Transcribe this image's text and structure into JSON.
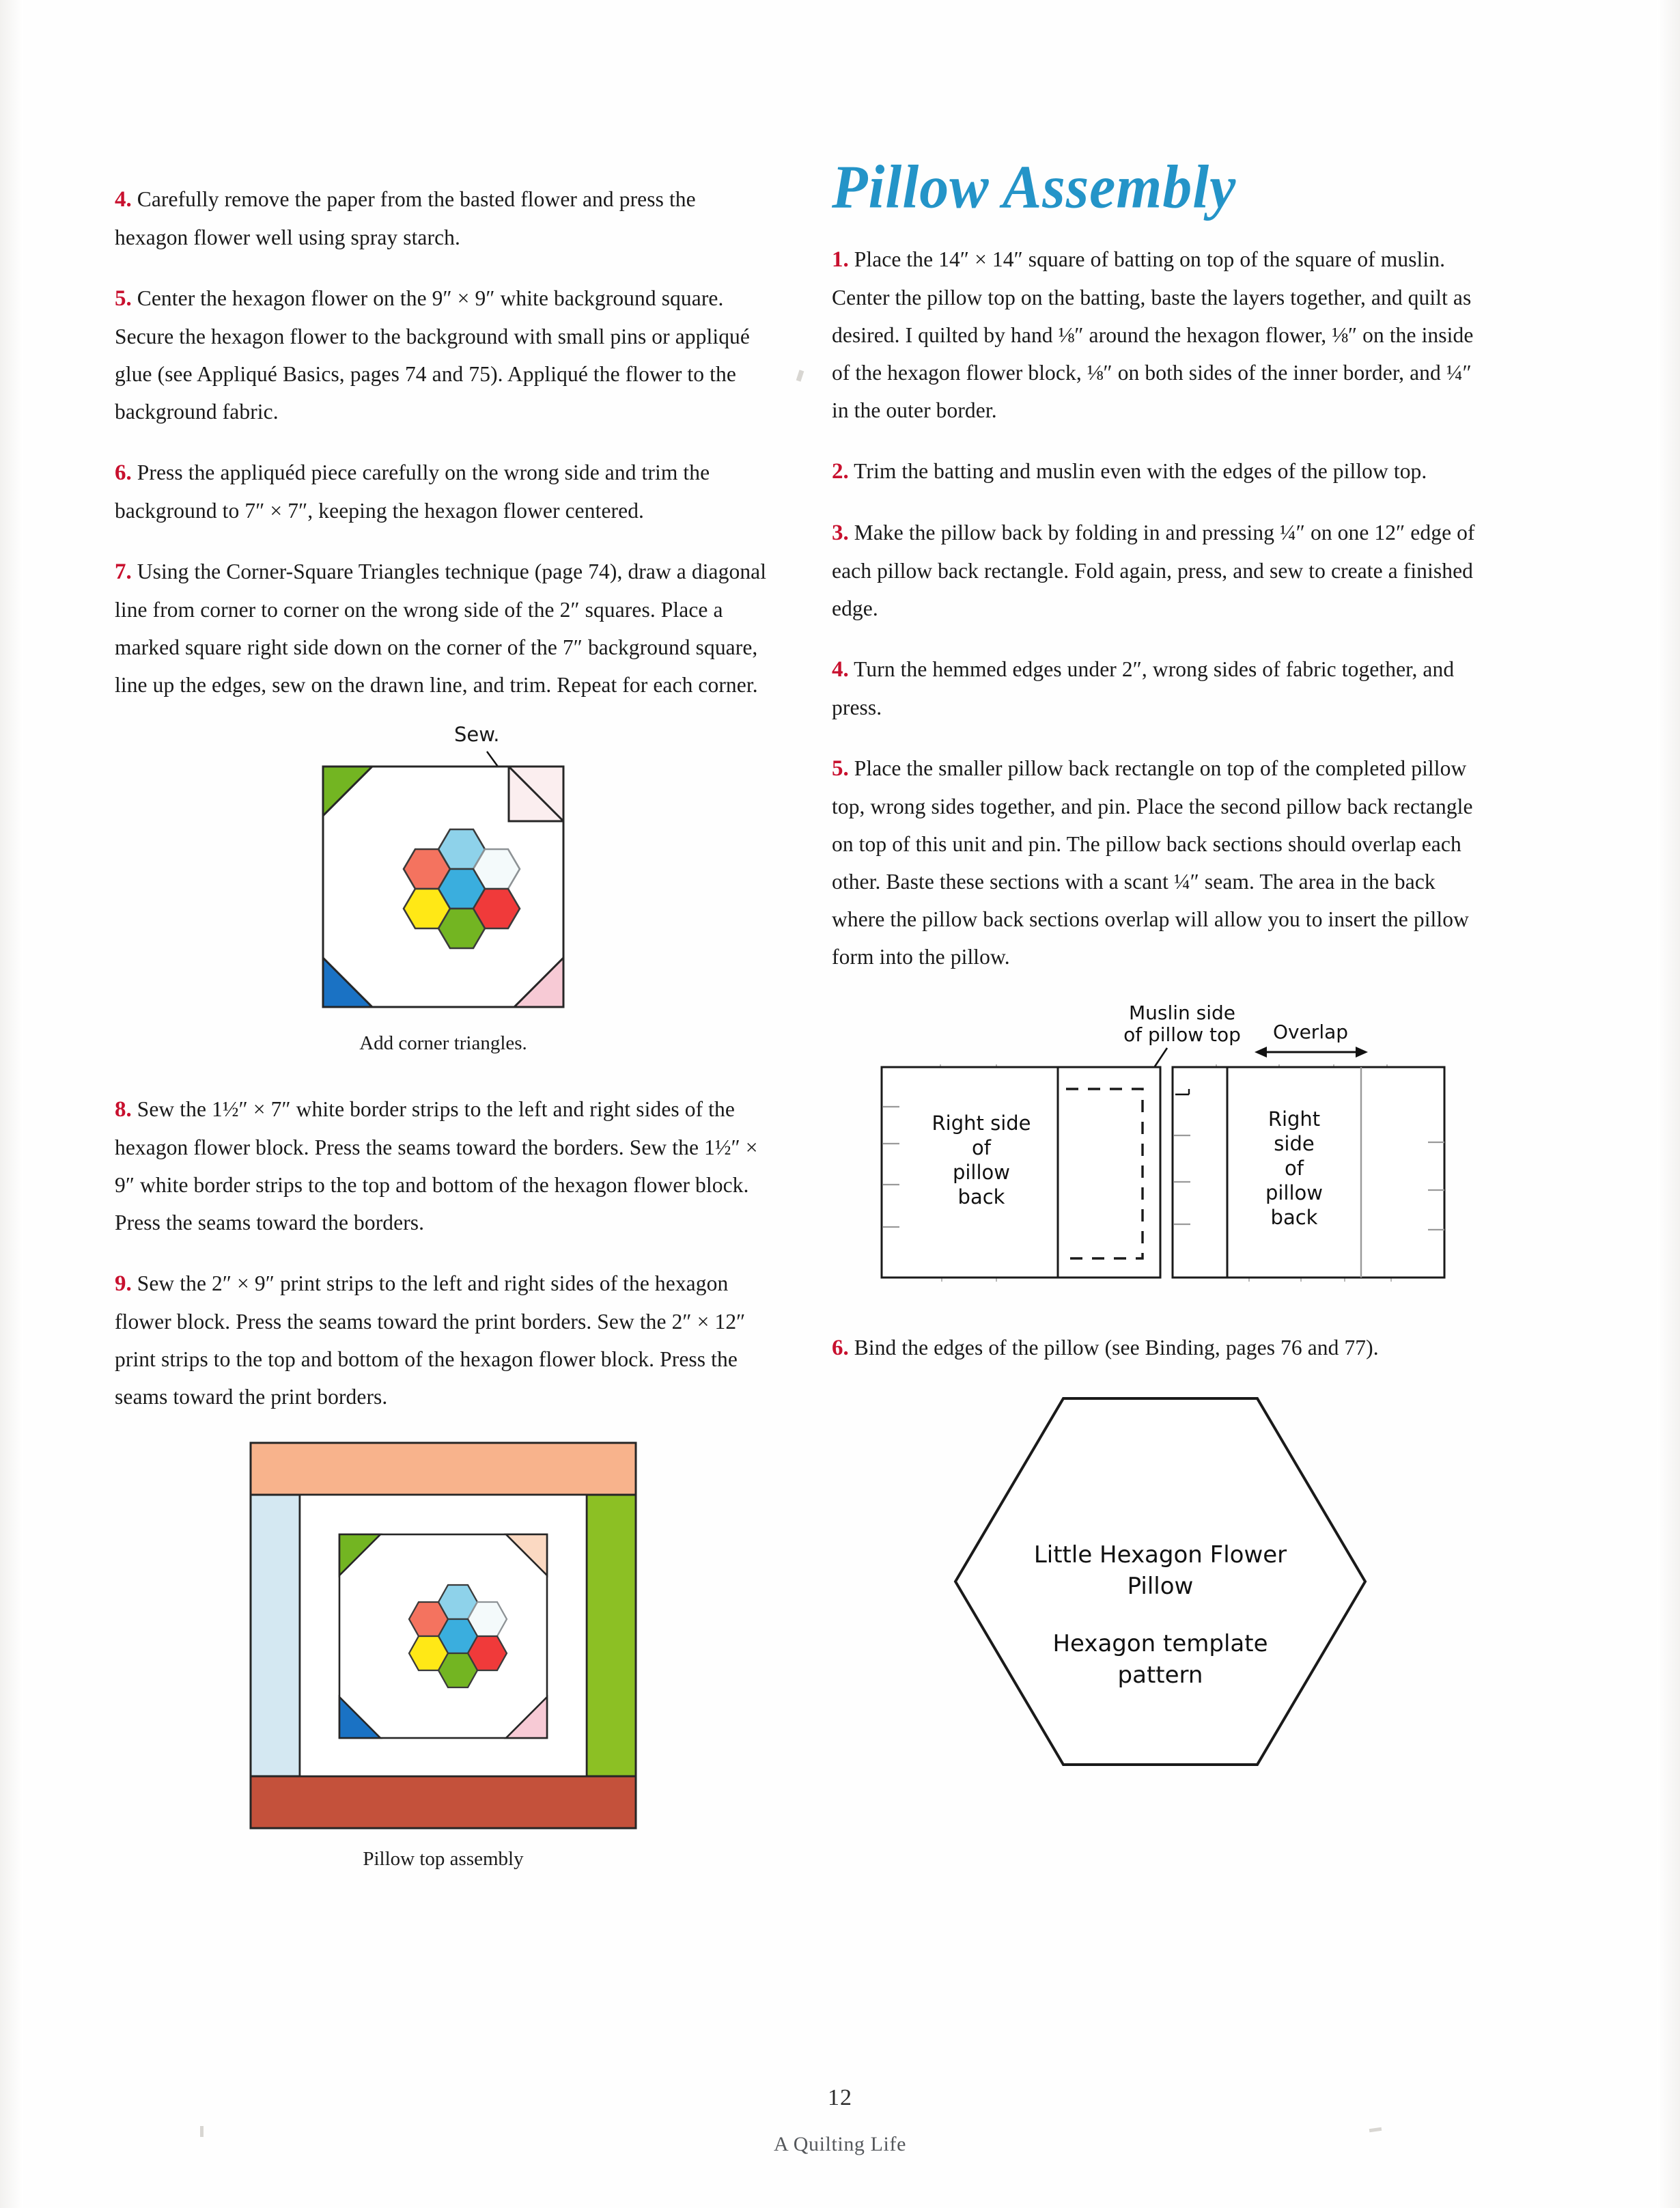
{
  "page": {
    "folio": "12",
    "book_title": "A Quilting Life"
  },
  "left_column": {
    "steps": [
      {
        "num": "4.",
        "text": "Carefully remove the paper from the basted flower and press the hexagon flower well using spray starch."
      },
      {
        "num": "5.",
        "text": "Center the hexagon flower on the 9″ × 9″ white background square. Secure the hexagon flower to the background with small pins or appliqué glue (see Appliqué Basics, pages 74 and 75). Appliqué the flower to the background fabric."
      },
      {
        "num": "6.",
        "text": "Press the appliquéd piece carefully on the wrong side and trim the background to 7″ × 7″, keeping the hexagon flower centered."
      },
      {
        "num": "7.",
        "text": "Using the Corner-Square Triangles technique (page 74), draw a diagonal line from corner to corner on the wrong side of the 2″ squares. Place a marked square right side down on the corner of the 7″ background square, line up the edges, sew on the drawn line, and trim. Repeat for each corner."
      }
    ],
    "steps_after_figure": [
      {
        "num": "8.",
        "text": "Sew the 1½″ × 7″ white border strips to the left and right sides of the hexagon flower block. Press the seams toward the borders. Sew the 1½″ × 9″ white border strips to the top and bottom of the hexagon flower block. Press the seams toward the borders."
      },
      {
        "num": "9.",
        "text": "Sew the 2″ × 9″ print strips to the left and right sides of the hexagon flower block. Press the seams toward the print borders. Sew the 2″ × 12″ print strips to the top and bottom of the hexagon flower block. Press the seams toward the print borders."
      }
    ],
    "figure_corner_triangles": {
      "sew_label": "Sew.",
      "caption": "Add corner triangles."
    },
    "figure_pillow_top": {
      "caption": "Pillow top assembly"
    }
  },
  "right_column": {
    "heading": "Pillow Assembly",
    "steps": [
      {
        "num": "1.",
        "text": "Place the 14″ × 14″ square of batting on top of the square of muslin. Center the pillow top on the batting, baste the layers together, and quilt as desired. I quilted by hand ⅛″ around the hexagon flower, ⅛″ on the inside of the hexagon flower block, ⅛″ on both sides of the inner border, and ¼″ in the outer border."
      },
      {
        "num": "2.",
        "text": "Trim the batting and muslin even with the edges of the pillow top."
      },
      {
        "num": "3.",
        "text": "Make the pillow back by folding in and pressing ¼″ on one 12″ edge of each pillow back rectangle. Fold again, press, and sew to create a finished edge."
      },
      {
        "num": "4.",
        "text": "Turn the hemmed edges under 2″, wrong sides of fabric together, and press."
      },
      {
        "num": "5.",
        "text": "Place the smaller pillow back rectangle on top of the completed pillow top, wrong sides together, and pin. Place the second pillow back rectangle on top of this unit and pin. The pillow back sections should overlap each other. Baste these sections with a scant ¼″ seam. The area in the back where the pillow back sections overlap will allow you to insert the pillow form into the pillow."
      }
    ],
    "steps_after_figure": [
      {
        "num": "6.",
        "text": "Bind the edges of the pillow (see Binding, pages 76 and 77)."
      }
    ],
    "figure_pillow_back": {
      "label_muslin": "Muslin side\nof pillow top",
      "label_muslin_line1": "Muslin side",
      "label_muslin_line2": "of pillow top",
      "label_overlap": "Overlap",
      "label_left_panel": "Right side\nof\npillow\nback",
      "label_left_lines": [
        "Right side",
        "of",
        "pillow",
        "back"
      ],
      "label_right_lines": [
        "Right",
        "side",
        "of",
        "pillow",
        "back"
      ]
    },
    "figure_hex_template": {
      "title_line1": "Little Hexagon Flower",
      "title_line2": "Pillow",
      "subtitle_line1": "Hexagon template",
      "subtitle_line2": "pattern"
    }
  },
  "colors": {
    "step_number_red": "#c8102e",
    "heading_blue": "#2494c8",
    "hex_center_blue": "#3aaede",
    "hex_top_lightblue": "#8ed2ea",
    "hex_upper_right_white": "#f4fafb",
    "hex_lower_right_red": "#f03a3a",
    "hex_bottom_green": "#73b522",
    "hex_lower_left_yellow": "#ffe816",
    "hex_upper_left_coral": "#f4735f",
    "corner_tri_green": "#73b522",
    "corner_tri_blue": "#1a72c4",
    "corner_tri_pink": "#f7cad5",
    "corner_tri_pale_pink": "#fbeeef",
    "border_peach": "#f8b38c",
    "border_lightblue": "#d4e8f2",
    "border_green": "#8cc024",
    "border_brick": "#c4513b"
  }
}
